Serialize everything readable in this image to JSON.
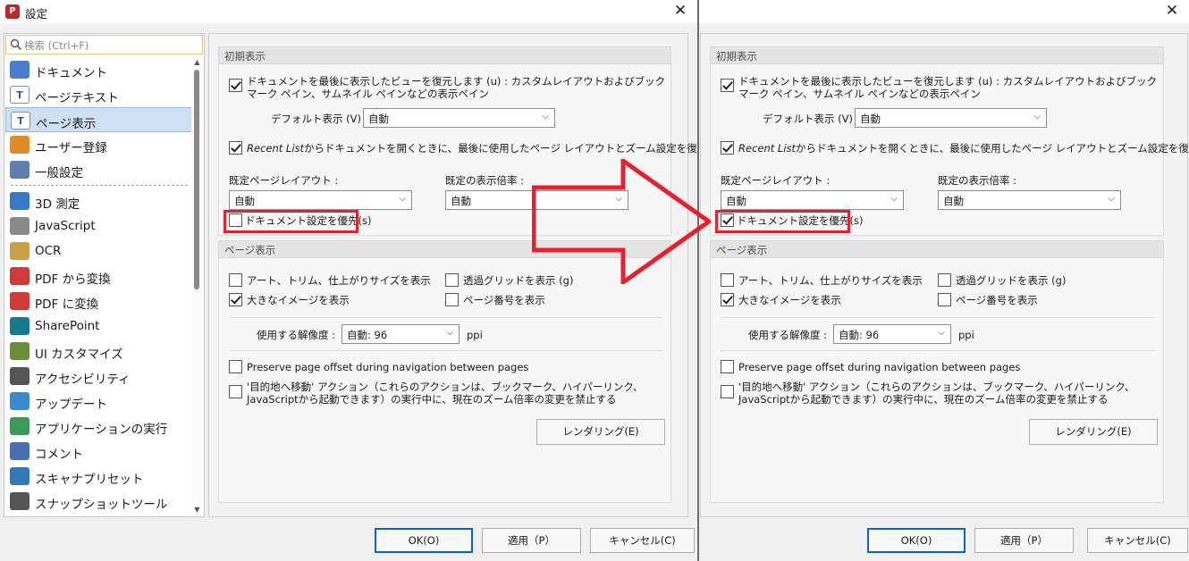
{
  "window": {
    "title": "設定",
    "app_icon": "pdf-editor-icon"
  },
  "nav": {
    "search_placeholder": "検索 (Ctrl+F)",
    "items": [
      {
        "label": "ドキュメント",
        "icon": "document-icon",
        "color": "#4a7bd0"
      },
      {
        "label": "ページテキスト",
        "icon": "text-icon",
        "color": "#ffffff"
      },
      {
        "label": "ページ表示",
        "icon": "page-display-icon",
        "color": "#ffffff"
      },
      {
        "label": "ユーザー登録",
        "icon": "user-icon",
        "color": "#e08a2a"
      },
      {
        "label": "一般設定",
        "icon": "settings-icon",
        "color": "#5f7fae"
      },
      {
        "label": "3D 測定",
        "icon": "3d-measure-icon",
        "color": "#3a78c8"
      },
      {
        "label": "JavaScript",
        "icon": "javascript-icon",
        "color": "#8a8a8a"
      },
      {
        "label": "OCR",
        "icon": "ocr-icon",
        "color": "#c9a04a"
      },
      {
        "label": "PDF から変換",
        "icon": "pdf-from-icon",
        "color": "#d23a3a"
      },
      {
        "label": "PDF に変換",
        "icon": "pdf-to-icon",
        "color": "#d23a3a"
      },
      {
        "label": "SharePoint",
        "icon": "sharepoint-icon",
        "color": "#137b8c"
      },
      {
        "label": "UI カスタマイズ",
        "icon": "ui-customize-icon",
        "color": "#6b8e3a"
      },
      {
        "label": "アクセシビリティ",
        "icon": "accessibility-icon",
        "color": "#555555"
      },
      {
        "label": "アップデート",
        "icon": "update-icon",
        "color": "#3a8bd2"
      },
      {
        "label": "アプリケーションの実行",
        "icon": "launch-app-icon",
        "color": "#3a9a5a"
      },
      {
        "label": "コメント",
        "icon": "comment-icon",
        "color": "#4a6fae"
      },
      {
        "label": "スキャナプリセット",
        "icon": "scanner-icon",
        "color": "#2f7ab8"
      },
      {
        "label": "スナップショットツール",
        "icon": "camera-icon",
        "color": "#555555"
      }
    ],
    "selected_index": 2
  },
  "panel": {
    "initial_group": "初期表示",
    "restore_view_label": "ドキュメントを最後に表示したビューを復元します (u) : カスタムレイアウトおよびブックマーク ペイン、サムネイル ペインなどの表示ペイン",
    "default_view_label": "デフォルト表示 (V) :",
    "default_view_value": "自動",
    "recent_list_em": "Recent List",
    "recent_list_rest": "からドキュメントを開くときに、最後に使用したページ レイアウトとズーム設定を復元する(t)",
    "page_layout_label": "既定ページレイアウト :",
    "page_layout_value": "自動",
    "zoom_label": "既定の表示倍率 :",
    "zoom_value": "自動",
    "prefer_doc_settings_label": "ドキュメント設定を優先(s)",
    "page_display_group": "ページ表示",
    "art_trim_label": "アート、トリム、仕上がりサイズを表示",
    "transparency_grid_label": "透過グリッドを表示 (g)",
    "large_images_label": "大きなイメージを表示",
    "page_numbers_label": "ページ番号を表示",
    "resolution_label": "使用する解像度 :",
    "resolution_value": "自動: 96",
    "resolution_unit": "ppi",
    "preserve_offset_label": "Preserve page offset during navigation between pages",
    "goto_action_label": "'目的地へ移動' アクション（これらのアクションは、ブックマーク、ハイパーリンク、JavaScriptから起動できます）の実行中に、現在のズーム倍率の変更を禁止する",
    "rendering_button": "レンダリング(E)"
  },
  "states": {
    "left": {
      "restore_view": true,
      "recent_list": true,
      "prefer_doc_settings": false,
      "art_trim": false,
      "transparency_grid": false,
      "large_images": true,
      "page_numbers": false,
      "preserve_offset": false,
      "goto_action": false
    },
    "right": {
      "restore_view": true,
      "recent_list": true,
      "prefer_doc_settings": true,
      "art_trim": false,
      "transparency_grid": false,
      "large_images": true,
      "page_numbers": false,
      "preserve_offset": false,
      "goto_action": false
    }
  },
  "buttons": {
    "ok": "OK(O)",
    "apply": "適用（P）",
    "cancel": "キャンセル(C)"
  },
  "colors": {
    "highlight": "#e3222e",
    "accent": "#0a64c8",
    "selection": "#cfe0f4"
  }
}
